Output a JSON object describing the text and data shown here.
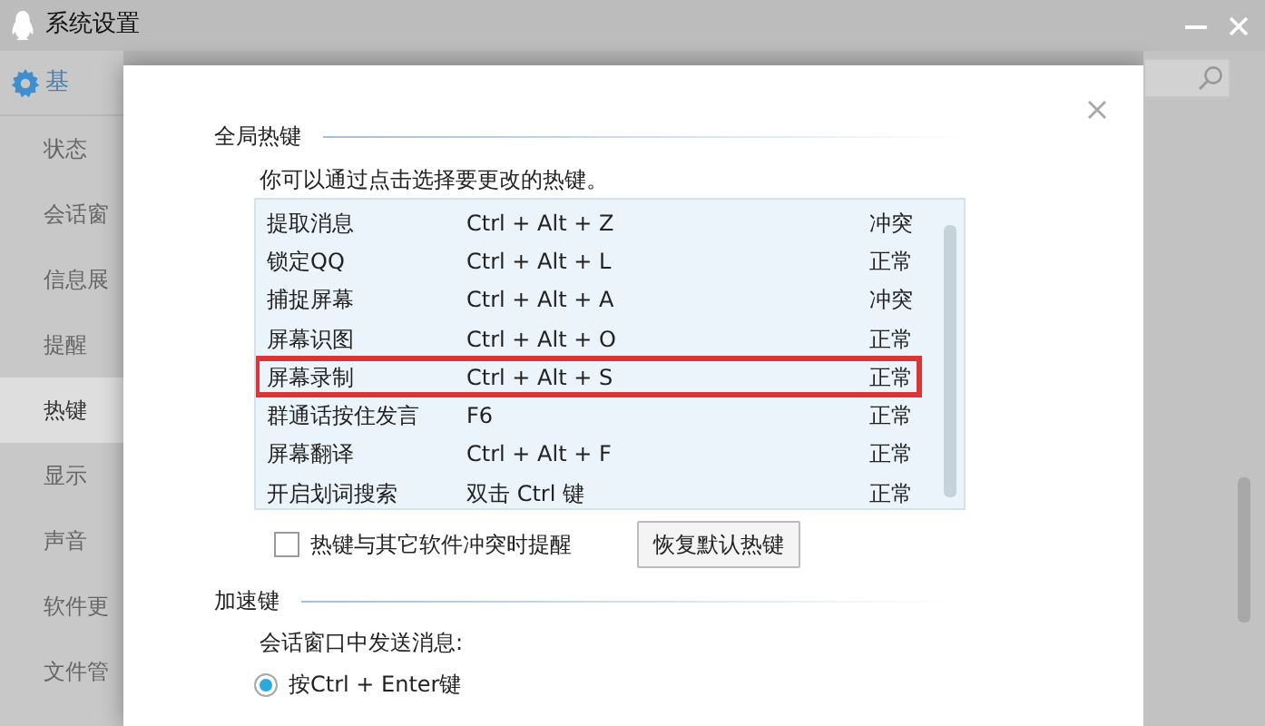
{
  "window": {
    "title": "系统设置"
  },
  "sidebar": {
    "items": [
      {
        "label": "基",
        "kind": "header",
        "selected": false
      },
      {
        "label": "状态",
        "kind": "item",
        "selected": false
      },
      {
        "label": "会话窗",
        "kind": "item",
        "selected": false
      },
      {
        "label": "信息展",
        "kind": "item",
        "selected": false
      },
      {
        "label": "提醒",
        "kind": "item",
        "selected": false
      },
      {
        "label": "热键",
        "kind": "item",
        "selected": true
      },
      {
        "label": "显示",
        "kind": "item",
        "selected": false
      },
      {
        "label": "声音",
        "kind": "item",
        "selected": false
      },
      {
        "label": "软件更",
        "kind": "item",
        "selected": false
      },
      {
        "label": "文件管",
        "kind": "item",
        "selected": false
      }
    ]
  },
  "dialog": {
    "hotkeys": {
      "title": "全局热键",
      "hint": "你可以通过点击选择要更改的热键。",
      "rows": [
        {
          "name": "提取消息",
          "keys": "Ctrl + Alt + Z",
          "status": "冲突",
          "highlighted": false
        },
        {
          "name": "锁定QQ",
          "keys": "Ctrl + Alt + L",
          "status": "正常",
          "highlighted": false
        },
        {
          "name": "捕捉屏幕",
          "keys": "Ctrl + Alt + A",
          "status": "冲突",
          "highlighted": false
        },
        {
          "name": "屏幕识图",
          "keys": "Ctrl + Alt + O",
          "status": "正常",
          "highlighted": false
        },
        {
          "name": "屏幕录制",
          "keys": "Ctrl + Alt + S",
          "status": "正常",
          "highlighted": true
        },
        {
          "name": "群通话按住发言",
          "keys": "F6",
          "status": "正常",
          "highlighted": false
        },
        {
          "name": "屏幕翻译",
          "keys": "Ctrl + Alt + F",
          "status": "正常",
          "highlighted": false
        },
        {
          "name": "开启划词搜索",
          "keys": "双击 Ctrl 键",
          "status": "正常",
          "highlighted": false
        }
      ],
      "conflict_alert": {
        "label": "热键与其它软件冲突时提醒",
        "checked": false
      },
      "reset_button": "恢复默认热键"
    },
    "accelerators": {
      "title": "加速键",
      "prompt": "会话窗口中发送消息:",
      "options": [
        {
          "label": "按Ctrl + Enter键",
          "selected": true
        }
      ]
    }
  }
}
